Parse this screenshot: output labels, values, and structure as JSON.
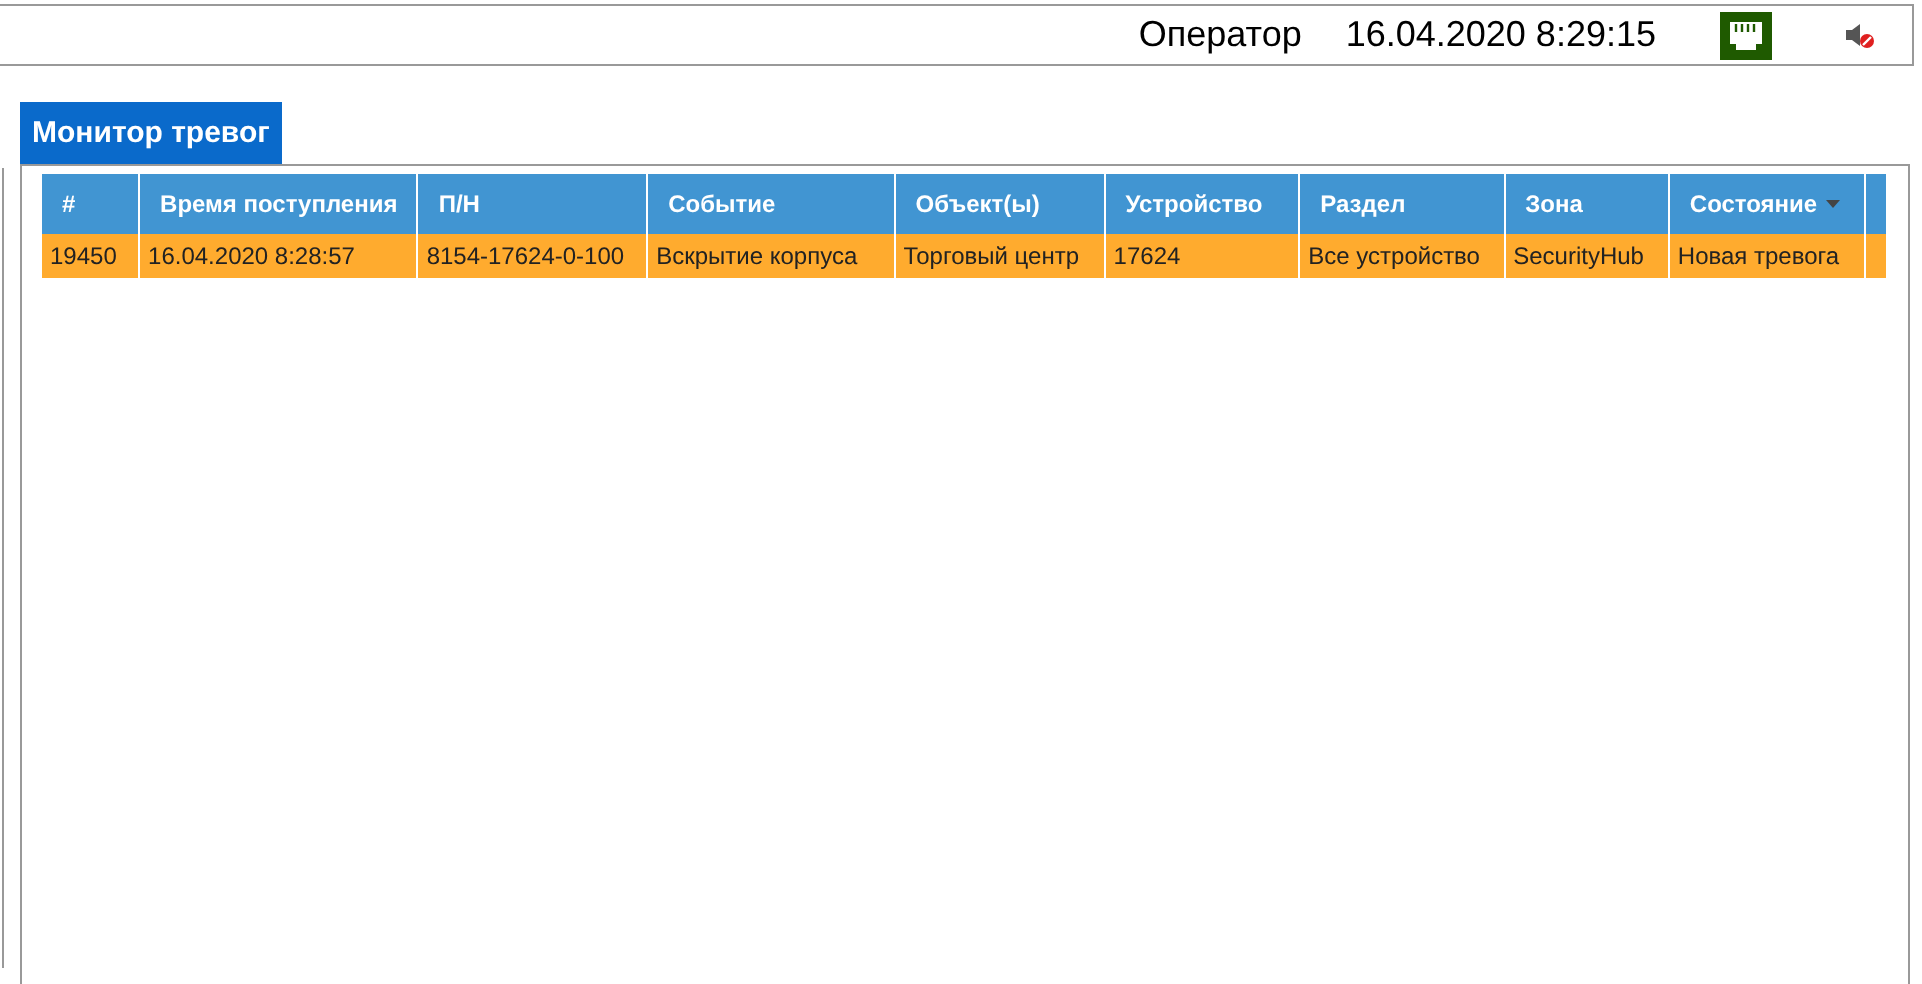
{
  "status_bar": {
    "operator": "Оператор",
    "datetime": "16.04.2020 8:29:15"
  },
  "tabs": [
    {
      "label": "Монитор тревог",
      "selected": true
    }
  ],
  "table": {
    "columns": [
      {
        "label": "#",
        "sorted": false
      },
      {
        "label": "Время поступления",
        "sorted": false
      },
      {
        "label": "П/Н",
        "sorted": false
      },
      {
        "label": "Событие",
        "sorted": false
      },
      {
        "label": "Объект(ы)",
        "sorted": false
      },
      {
        "label": "Устройство",
        "sorted": false
      },
      {
        "label": "Раздел",
        "sorted": false
      },
      {
        "label": "Зона",
        "sorted": false
      },
      {
        "label": "Состояние",
        "sorted": true
      }
    ],
    "rows": [
      {
        "cells": [
          "19450",
          "16.04.2020 8:28:57",
          "8154-17624-0-100",
          "Вскрытие корпуса",
          "Торговый центр",
          "17624",
          "Все устройство",
          "SecurityHub",
          "Новая тревога"
        ]
      }
    ]
  }
}
